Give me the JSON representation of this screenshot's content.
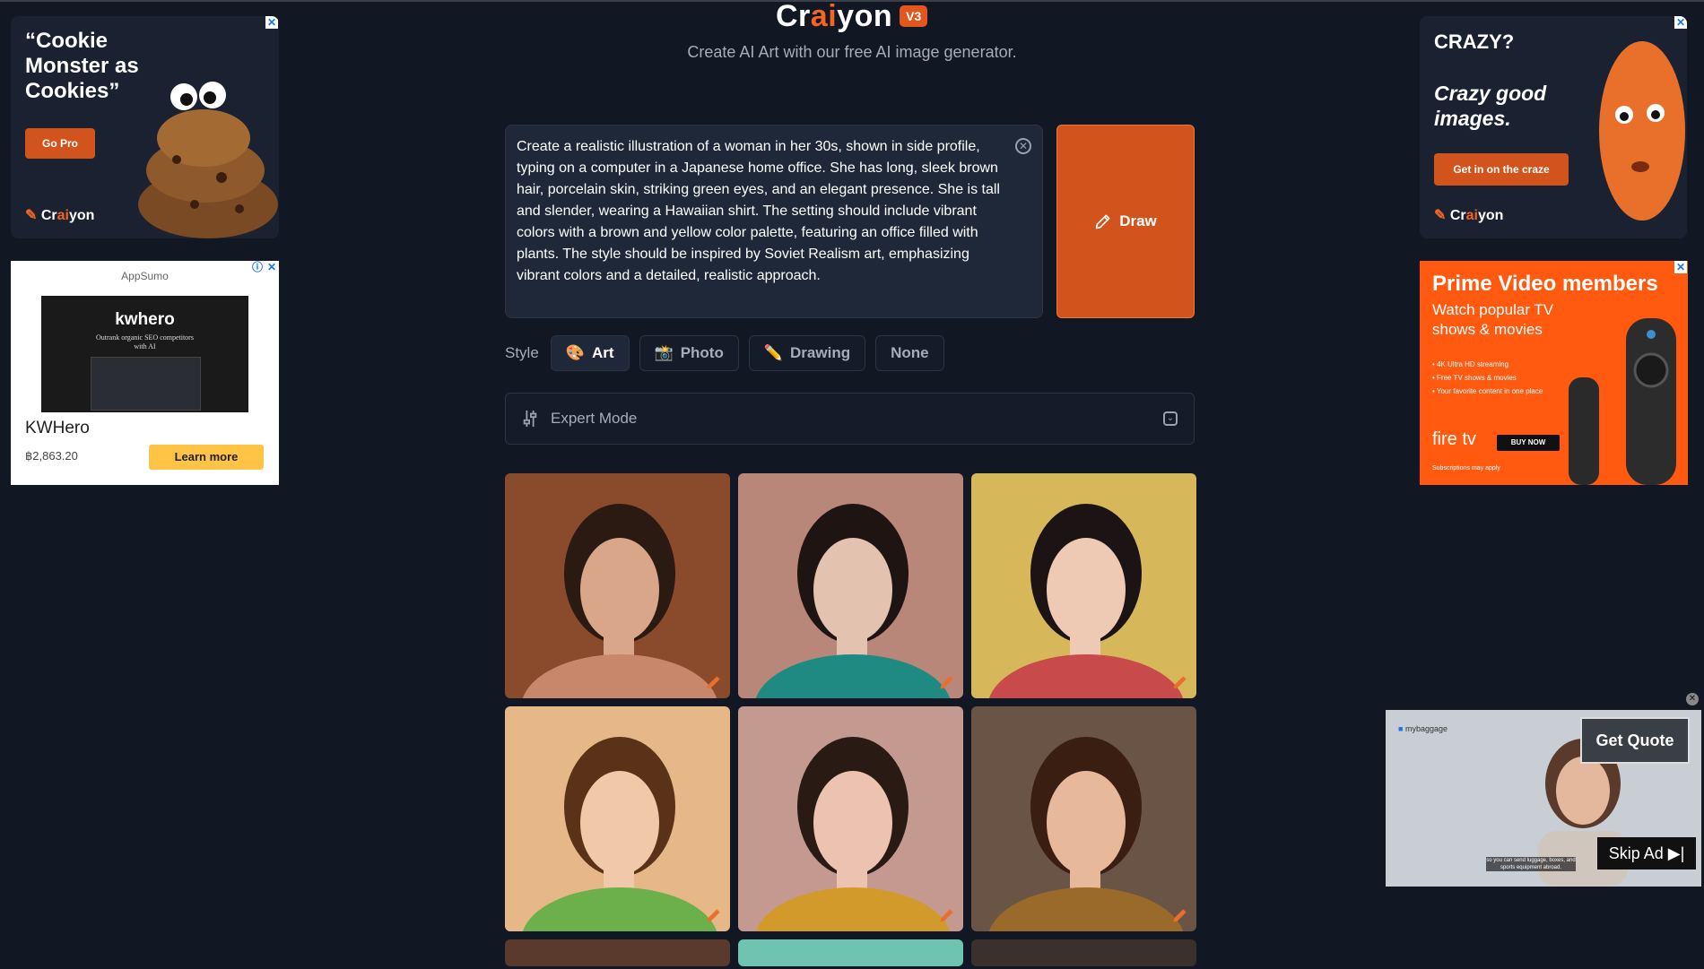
{
  "header": {
    "logo_prefix": "Cr",
    "logo_ai": "ai",
    "logo_suffix": "yon",
    "version_badge": "V3",
    "subtitle": "Create AI Art with our free AI image generator."
  },
  "prompt": {
    "value": "Create a realistic illustration of a woman in her 30s, shown in side profile, typing on a computer in a Japanese home office. She has long, sleek brown hair, porcelain skin, striking green eyes, and an elegant presence. She is tall and slender, wearing a Hawaiian shirt. The setting should include vibrant colors with a brown and yellow color palette, featuring an office filled with plants. The style should be inspired by Soviet Realism art, emphasizing vibrant colors and a detailed, realistic approach.",
    "draw_label": "Draw"
  },
  "style": {
    "label": "Style",
    "options": [
      {
        "label": "Art",
        "icon": "palette-icon",
        "glyph": "🎨",
        "active": true
      },
      {
        "label": "Photo",
        "icon": "camera-icon",
        "glyph": "📸",
        "active": false
      },
      {
        "label": "Drawing",
        "icon": "pencil-icon",
        "glyph": "✏️",
        "active": false
      },
      {
        "label": "None",
        "icon": "",
        "glyph": "",
        "active": false
      }
    ]
  },
  "expert_mode": {
    "label": "Expert Mode"
  },
  "results": {
    "tiles": [
      {
        "bg": "#8a4a2c",
        "hair": "#2b1a12",
        "skin": "#d9a68a",
        "cloth": "#c8866a"
      },
      {
        "bg": "#b8877a",
        "hair": "#1e1412",
        "skin": "#e4c2b0",
        "cloth": "#1f8a82"
      },
      {
        "bg": "#d6b85a",
        "hair": "#1c1414",
        "skin": "#eecab4",
        "cloth": "#c94a4a"
      },
      {
        "bg": "#e6b888",
        "hair": "#5a3218",
        "skin": "#f0c9a8",
        "cloth": "#6bb04a"
      },
      {
        "bg": "#c49a90",
        "hair": "#2a1a14",
        "skin": "#ecc2b0",
        "cloth": "#d29a2a"
      },
      {
        "bg": "#6a5446",
        "hair": "#3a1e12",
        "skin": "#e8b89a",
        "cloth": "#9a6a2a"
      }
    ],
    "partial_tiles": [
      {
        "bg": "#5a3a2c"
      },
      {
        "bg": "#6ec4b0"
      },
      {
        "bg": "#3a302c"
      }
    ]
  },
  "ads": {
    "cookie": {
      "headline": "“Cookie Monster as Cookies”",
      "button": "Go Pro",
      "brand_prefix": "Cr",
      "brand_ai": "ai",
      "brand_suffix": "yon"
    },
    "crazy": {
      "title": "CRAZY?",
      "headline": "Crazy good images.",
      "button": "Get in on the craze",
      "brand_prefix": "Cr",
      "brand_ai": "ai",
      "brand_suffix": "yon"
    },
    "kwhero": {
      "sponsor": "AppSumo",
      "screen_logo": "kwhero",
      "screen_tagline": "Outrank organic SEO competitors with AI",
      "name": "KWHero",
      "price": "฿2,863.20",
      "button": "Learn more"
    },
    "prime": {
      "title": "Prime Video members",
      "subtitle": "Watch popular TV shows & movies",
      "bullets": [
        "• 4K Ultra HD streaming",
        "• Free TV shows & movies",
        "• Your favorite content in one place"
      ],
      "brand": "fire tv",
      "button": "BUY NOW",
      "fine_print": "Subscriptions may apply"
    },
    "video": {
      "brand": "mybaggage",
      "cta": "Get Quote",
      "skip": "Skip Ad ▶|",
      "caption": "so you can send luggage, boxes, and sports equipment abroad."
    }
  }
}
